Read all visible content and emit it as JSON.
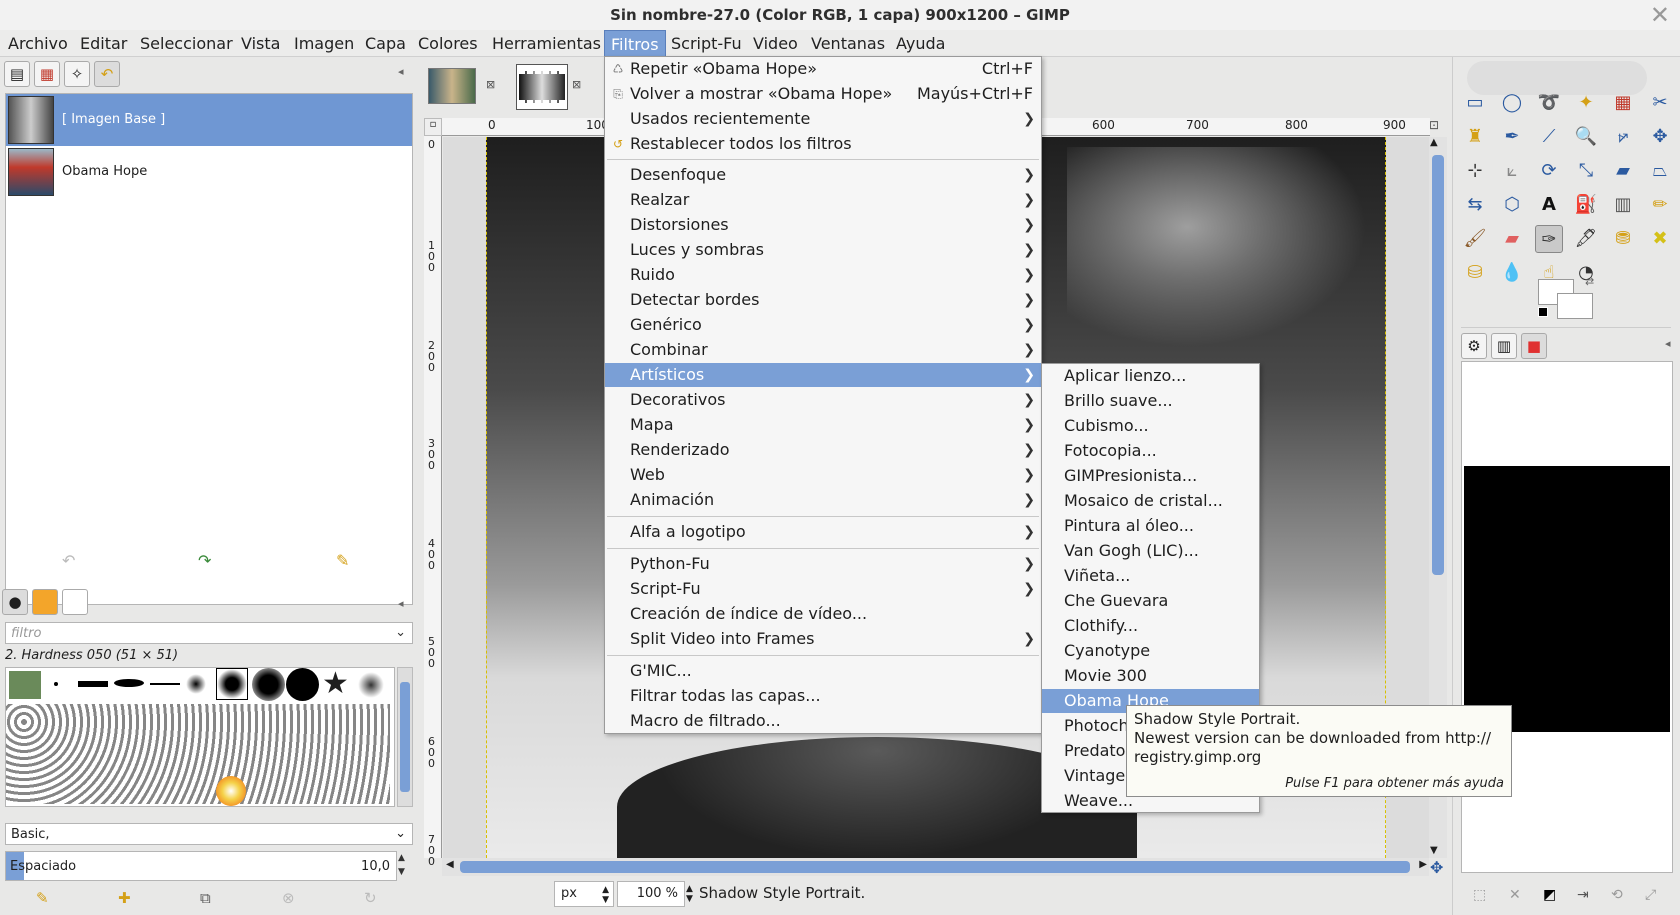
{
  "window": {
    "title": "Sin nombre-27.0 (Color RGB, 1 capa) 900x1200 – GIMP",
    "close_icon": "close-icon"
  },
  "menubar": {
    "items": [
      "Archivo",
      "Editar",
      "Seleccionar",
      "Vista",
      "Imagen",
      "Capa",
      "Colores",
      "Herramientas",
      "Filtros",
      "Script-Fu",
      "Video",
      "Ventanas",
      "Ayuda"
    ],
    "active": "Filtros"
  },
  "layers": {
    "items": [
      "[ Imagen Base ]",
      "Obama Hope"
    ]
  },
  "brushes": {
    "filter_placeholder": "filtro",
    "current": "2. Hardness 050 (51 × 51)",
    "preset": "Basic,",
    "spacing_label": "Espaciado",
    "spacing_value": "10,0"
  },
  "image_tabs": [
    "tab-1",
    "tab-2"
  ],
  "ruler": {
    "h_ticks": [
      "0",
      "100",
      "600",
      "700",
      "800",
      "900"
    ],
    "v_ticks": [
      "0",
      "1 0 0",
      "2 0 0",
      "3 0 0",
      "4 0 0",
      "5 0 0",
      "6 0 0",
      "7 0 0"
    ]
  },
  "filters_menu": {
    "top": [
      {
        "label": "Repetir «Obama Hope»",
        "shortcut": "Ctrl+F"
      },
      {
        "label": "Volver a mostrar «Obama Hope»",
        "shortcut": "Mayús+Ctrl+F"
      },
      {
        "label": "Usados recientemente",
        "shortcut": ""
      },
      {
        "label": "Restablecer todos los filtros",
        "shortcut": ""
      }
    ],
    "groups": [
      "Desenfoque",
      "Realzar",
      "Distorsiones",
      "Luces y sombras",
      "Ruido",
      "Detectar bordes",
      "Genérico",
      "Combinar",
      "Artísticos",
      "Decorativos",
      "Mapa",
      "Renderizado",
      "Web",
      "Animación"
    ],
    "logo": "Alfa a logotipo",
    "scripts": [
      "Python-Fu",
      "Script-Fu",
      "Creación de índice de vídeo...",
      "Split Video into Frames"
    ],
    "bottom": [
      "G'MIC...",
      "Filtrar todas las capas...",
      "Macro de filtrado..."
    ],
    "highlight": "Artísticos"
  },
  "artisticos_menu": {
    "items": [
      "Aplicar lienzo...",
      "Brillo suave...",
      "Cubismo...",
      "Fotocopia...",
      "GIMPresionista...",
      "Mosaico de cristal...",
      "Pintura al óleo...",
      "Van Gogh (LIC)...",
      "Viñeta...",
      "Che Guevara",
      "Clothify...",
      "Cyanotype",
      "Movie 300",
      "Obama Hope",
      "Photoch",
      "Predato",
      "Vintage",
      "Weave..."
    ],
    "highlight": "Obama Hope"
  },
  "tooltip": {
    "line1": "Shadow Style Portrait.",
    "line2": "Newest version can be downloaded from http://",
    "line3": "registry.gimp.org",
    "help": "Pulse F1 para obtener más ayuda"
  },
  "statusbar": {
    "unit": "px",
    "zoom": "100 %",
    "message": "Shadow Style Portrait."
  },
  "colors": {
    "accent": "#7a9fd6",
    "fg": "#000000",
    "bg": "#ffffff"
  }
}
